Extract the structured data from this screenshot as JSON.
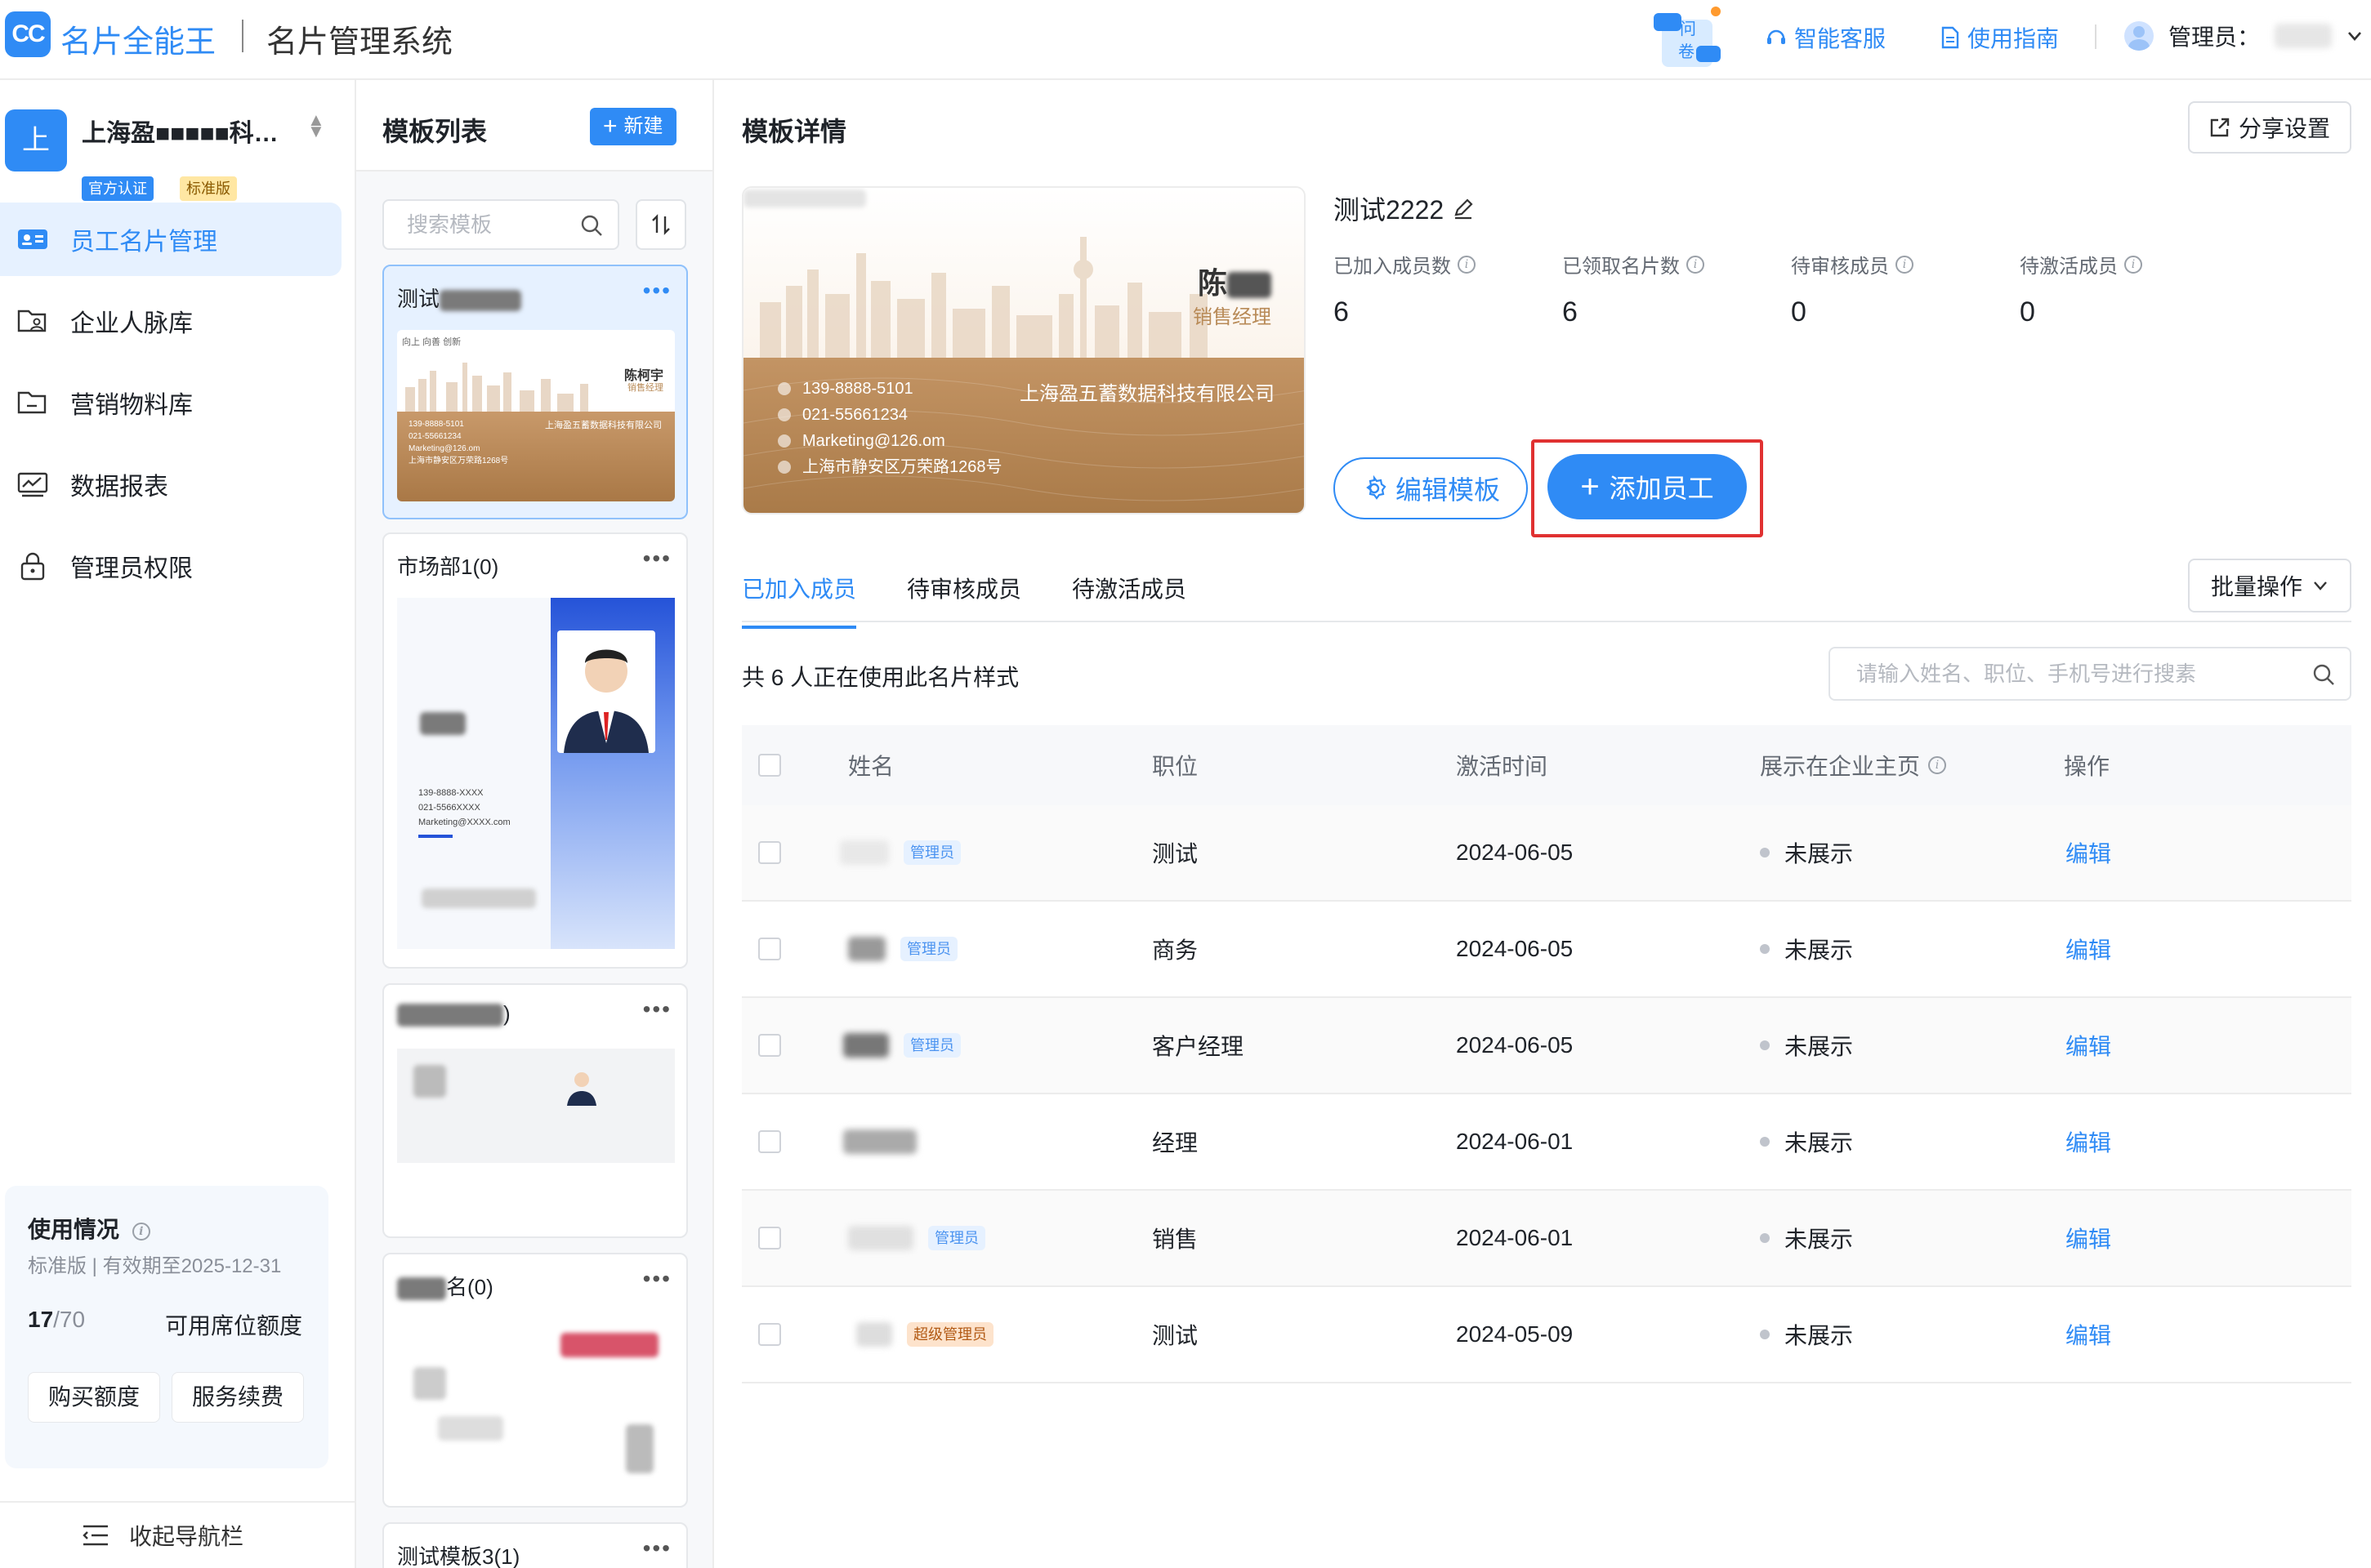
{
  "app": {
    "logo_text": "CC",
    "brand": "名片全能王",
    "title": "名片管理系统"
  },
  "topbar": {
    "survey_label": "问卷",
    "ai_service": "智能客服",
    "guide": "使用指南",
    "admin_label": "管理员："
  },
  "nav": {
    "org_avatar": "上",
    "org_name": "上海盈■■■■■科…",
    "tag_auth": "官方认证",
    "tag_version": "标准版",
    "items": [
      {
        "label": "员工名片管理",
        "icon": "id-card-icon",
        "active": true
      },
      {
        "label": "企业人脉库",
        "icon": "contacts-folder-icon",
        "active": false
      },
      {
        "label": "营销物料库",
        "icon": "folder-icon",
        "active": false
      },
      {
        "label": "数据报表",
        "icon": "chart-icon",
        "active": false
      },
      {
        "label": "管理员权限",
        "icon": "lock-icon",
        "active": false
      }
    ],
    "usage": {
      "title": "使用情况",
      "subtitle": "标准版 | 有效期至2025-12-31",
      "used": "17",
      "total": "/70",
      "label": "可用席位额度",
      "buy_btn": "购买额度",
      "renew_btn": "服务续费"
    },
    "collapse": "收起导航栏"
  },
  "templates": {
    "title": "模板列表",
    "new_btn": "新建",
    "search_placeholder": "搜索模板",
    "items": [
      {
        "title": "测试■■■■■",
        "active": true
      },
      {
        "title": "市场部1(0)",
        "active": false
      },
      {
        "title": "■■■■■)",
        "active": false
      },
      {
        "title": "■■名(0)",
        "active": false
      },
      {
        "title": "测试模板3(1)",
        "active": false
      }
    ],
    "card_preview": {
      "slogan": "向上 向善 创新",
      "name": "陈柯宇",
      "title": "销售经理",
      "company": "上海盈五蓄数据科技有限公司",
      "phone": "139-8888-5101",
      "tel": "021-55661234",
      "email": "Marketing@126.om",
      "address": "上海市静安区万荣路1268号"
    },
    "market_preview": {
      "lines": [
        "139-8888-XXXX",
        "021-5566XXXX",
        "Marketing@XXXX.com"
      ]
    }
  },
  "detail": {
    "title": "模板详情",
    "share_btn": "分享设置",
    "template_name": "测试2222",
    "card": {
      "name": "陈■■",
      "title": "销售经理",
      "company": "上海盈五蓄数据科技有限公司",
      "phone": "139-8888-5101",
      "tel": "021-55661234",
      "email": "Marketing@126.om",
      "address": "上海市静安区万荣路1268号"
    },
    "stats": [
      {
        "label": "已加入成员数",
        "value": "6"
      },
      {
        "label": "已领取名片数",
        "value": "6"
      },
      {
        "label": "待审核成员",
        "value": "0"
      },
      {
        "label": "待激活成员",
        "value": "0"
      }
    ],
    "edit_tpl_btn": "编辑模板",
    "add_btn": "添加员工",
    "tabs": [
      "已加入成员",
      "待审核成员",
      "待激活成员"
    ],
    "batch_btn": "批量操作",
    "count_text": "共 6 人正在使用此名片样式",
    "search_placeholder": "请输入姓名、职位、手机号进行搜素",
    "columns": [
      "姓名",
      "职位",
      "激活时间",
      "展示在企业主页",
      "操作"
    ],
    "rows": [
      {
        "role": "管理员",
        "position": "测试",
        "time": "2024-06-05",
        "status": "未展示",
        "action": "编辑"
      },
      {
        "role": "管理员",
        "position": "商务",
        "time": "2024-06-05",
        "status": "未展示",
        "action": "编辑"
      },
      {
        "role": "管理员",
        "position": "客户经理",
        "time": "2024-06-05",
        "status": "未展示",
        "action": "编辑"
      },
      {
        "role": "",
        "position": "经理",
        "time": "2024-06-01",
        "status": "未展示",
        "action": "编辑"
      },
      {
        "role": "管理员",
        "position": "销售",
        "time": "2024-06-01",
        "status": "未展示",
        "action": "编辑"
      },
      {
        "role": "超级管理员",
        "position": "测试",
        "time": "2024-05-09",
        "status": "未展示",
        "action": "编辑"
      }
    ]
  },
  "colors": {
    "accent": "#2f8bf5",
    "highlight": "#e03131",
    "card_gold": "#b88a57"
  }
}
